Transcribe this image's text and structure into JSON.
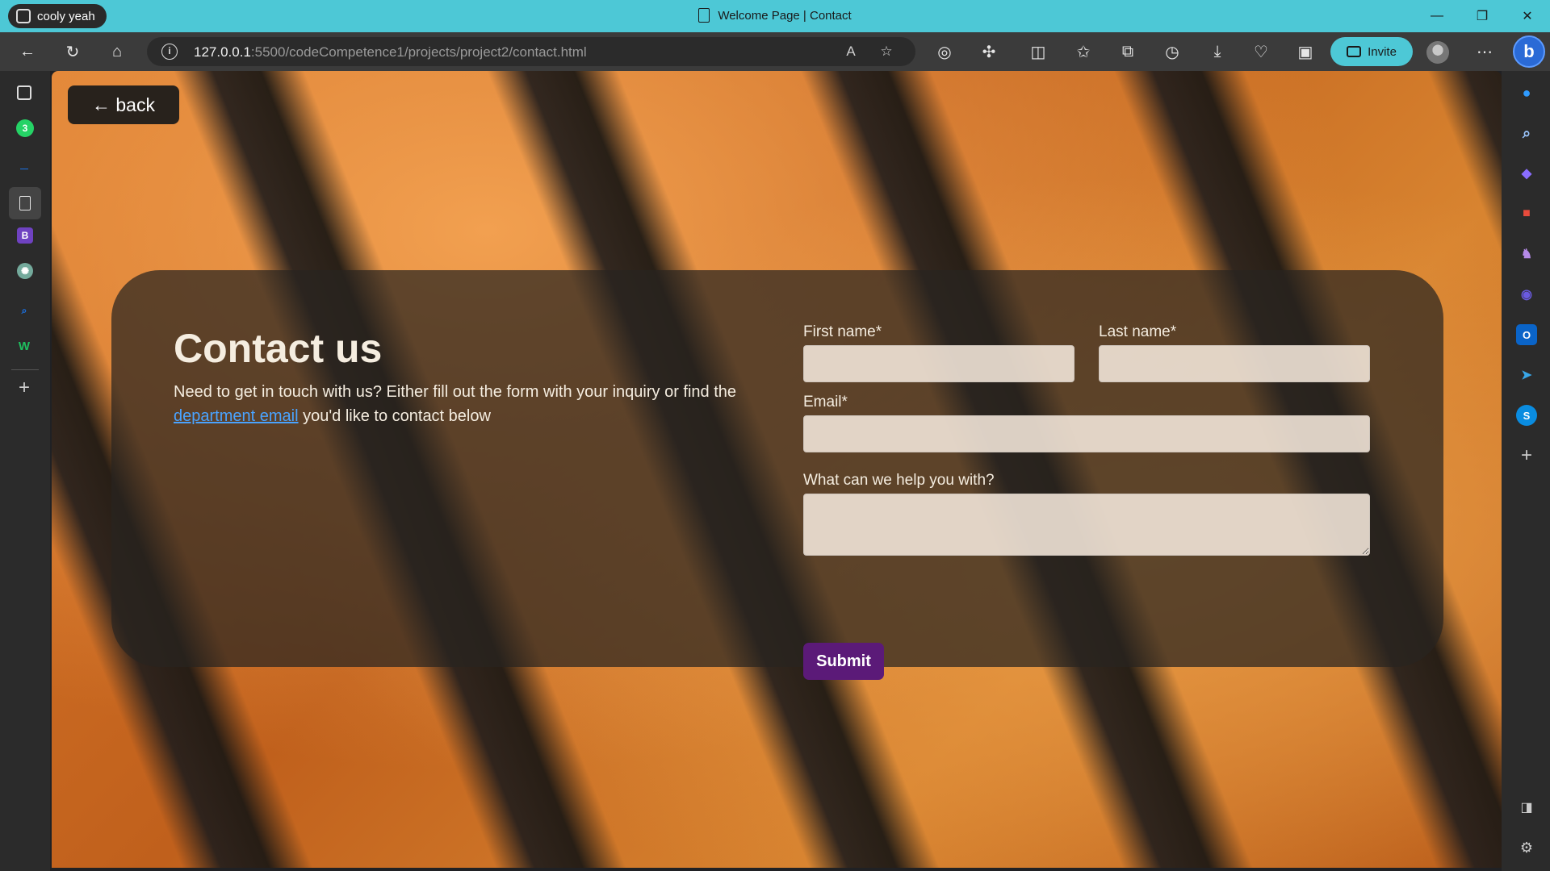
{
  "window": {
    "profile_name": "cooly yeah",
    "title": "Welcome Page | Contact",
    "controls": [
      "—",
      "❐",
      "✕"
    ]
  },
  "toolbar": {
    "url_host": "127.0.0.1",
    "url_path": ":5500/codeCompetence1/projects/project2/contact.html",
    "invite_label": "Invite"
  },
  "page": {
    "back_label": "← back",
    "heading": "Contact us",
    "intro_text_before": "Need to get in touch with us? Either fill out the form with your inquiry or find the ",
    "intro_link": "department email",
    "intro_text_after": " you'd like to contact below",
    "form": {
      "first_name_label": "First name*",
      "last_name_label": "Last name*",
      "email_label": "Email*",
      "message_label": "What can we help you with?",
      "first_name_value": "",
      "last_name_value": "",
      "email_value": "",
      "message_value": "",
      "submit_label": "Submit"
    }
  },
  "left_sidebar": {
    "whatsapp_badge": "3",
    "bootstrap_letter": "B",
    "w_letter": "W"
  },
  "right_sidebar": {
    "skype_letter": "S",
    "outlook_letter": "O"
  },
  "colors": {
    "titlebar": "#4dc8d6",
    "submit": "#5b1a78",
    "link": "#4aa3ff"
  }
}
